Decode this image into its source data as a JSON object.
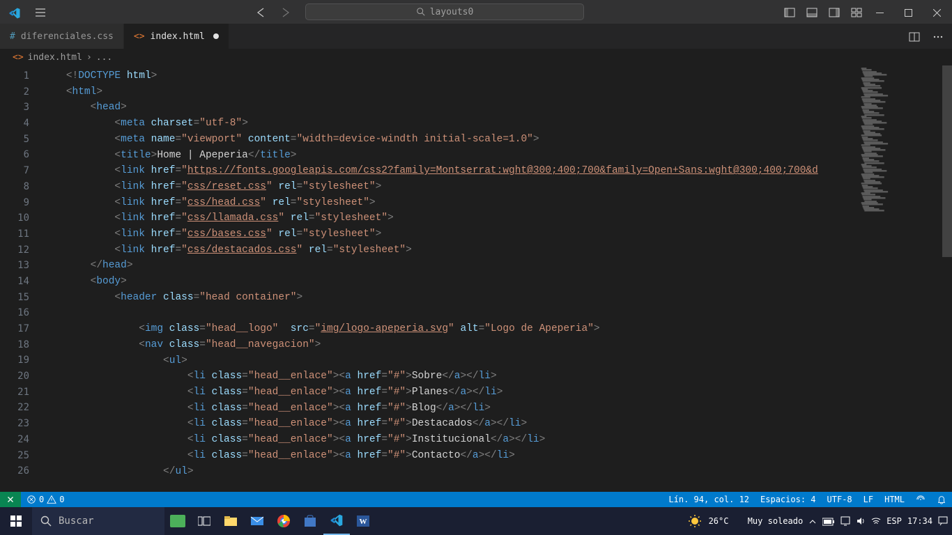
{
  "title_search": "layouts0",
  "tabs": [
    {
      "name": "diferenciales.css",
      "active": false,
      "lang": "css"
    },
    {
      "name": "index.html",
      "active": true,
      "lang": "html",
      "dirty": true
    }
  ],
  "breadcrumb": {
    "file": "index.html",
    "trail": "..."
  },
  "line_numbers": [
    "1",
    "2",
    "3",
    "4",
    "5",
    "6",
    "7",
    "8",
    "9",
    "10",
    "11",
    "12",
    "13",
    "14",
    "15",
    "16",
    "17",
    "18",
    "19",
    "20",
    "21",
    "22",
    "23",
    "24",
    "25",
    "26"
  ],
  "code": {
    "l1": {
      "indent": "    ",
      "tokens": [
        [
          "p",
          "<!"
        ],
        [
          "t",
          "DOCTYPE "
        ],
        [
          "a",
          "html"
        ],
        [
          "p",
          ">"
        ]
      ]
    },
    "l2": {
      "indent": "    ",
      "tokens": [
        [
          "p",
          "<"
        ],
        [
          "t",
          "html"
        ],
        [
          "p",
          ">"
        ]
      ]
    },
    "l3": {
      "indent": "        ",
      "tokens": [
        [
          "p",
          "<"
        ],
        [
          "t",
          "head"
        ],
        [
          "p",
          ">"
        ]
      ]
    },
    "l4": {
      "indent": "            ",
      "tokens": [
        [
          "p",
          "<"
        ],
        [
          "t",
          "meta "
        ],
        [
          "a",
          "charset"
        ],
        [
          "p",
          "="
        ],
        [
          "s",
          "\"utf-8\""
        ],
        [
          "p",
          ">"
        ]
      ]
    },
    "l5": {
      "indent": "            ",
      "tokens": [
        [
          "p",
          "<"
        ],
        [
          "t",
          "meta "
        ],
        [
          "a",
          "name"
        ],
        [
          "p",
          "="
        ],
        [
          "s",
          "\"viewport\" "
        ],
        [
          "a",
          "content"
        ],
        [
          "p",
          "="
        ],
        [
          "s",
          "\"width=device-windth initial-scale=1.0\""
        ],
        [
          "p",
          ">"
        ]
      ]
    },
    "l6": {
      "indent": "            ",
      "tokens": [
        [
          "p",
          "<"
        ],
        [
          "t",
          "title"
        ],
        [
          "p",
          ">"
        ],
        [
          "x",
          "Home | Apeperia"
        ],
        [
          "p",
          "</"
        ],
        [
          "t",
          "title"
        ],
        [
          "p",
          ">"
        ]
      ]
    },
    "l7": {
      "indent": "            ",
      "tokens": [
        [
          "p",
          "<"
        ],
        [
          "t",
          "link "
        ],
        [
          "a",
          "href"
        ],
        [
          "p",
          "="
        ],
        [
          "s",
          "\""
        ],
        [
          "su",
          "https://fonts.googleapis.com/css2?family=Montserrat:wght@300;400;700&family=Open+Sans:wght@300;400;700&d"
        ]
      ]
    },
    "l8": {
      "indent": "            ",
      "tokens": [
        [
          "p",
          "<"
        ],
        [
          "t",
          "link "
        ],
        [
          "a",
          "href"
        ],
        [
          "p",
          "="
        ],
        [
          "s",
          "\""
        ],
        [
          "su",
          "css/reset.css"
        ],
        [
          "s",
          "\" "
        ],
        [
          "a",
          "rel"
        ],
        [
          "p",
          "="
        ],
        [
          "s",
          "\"stylesheet\""
        ],
        [
          "p",
          ">"
        ]
      ]
    },
    "l9": {
      "indent": "            ",
      "tokens": [
        [
          "p",
          "<"
        ],
        [
          "t",
          "link "
        ],
        [
          "a",
          "href"
        ],
        [
          "p",
          "="
        ],
        [
          "s",
          "\""
        ],
        [
          "su",
          "css/head.css"
        ],
        [
          "s",
          "\" "
        ],
        [
          "a",
          "rel"
        ],
        [
          "p",
          "="
        ],
        [
          "s",
          "\"stylesheet\""
        ],
        [
          "p",
          ">"
        ]
      ]
    },
    "l10": {
      "indent": "            ",
      "tokens": [
        [
          "p",
          "<"
        ],
        [
          "t",
          "link "
        ],
        [
          "a",
          "href"
        ],
        [
          "p",
          "="
        ],
        [
          "s",
          "\""
        ],
        [
          "su",
          "css/llamada.css"
        ],
        [
          "s",
          "\" "
        ],
        [
          "a",
          "rel"
        ],
        [
          "p",
          "="
        ],
        [
          "s",
          "\"stylesheet\""
        ],
        [
          "p",
          ">"
        ]
      ]
    },
    "l11": {
      "indent": "            ",
      "tokens": [
        [
          "p",
          "<"
        ],
        [
          "t",
          "link "
        ],
        [
          "a",
          "href"
        ],
        [
          "p",
          "="
        ],
        [
          "s",
          "\""
        ],
        [
          "su",
          "css/bases.css"
        ],
        [
          "s",
          "\" "
        ],
        [
          "a",
          "rel"
        ],
        [
          "p",
          "="
        ],
        [
          "s",
          "\"stylesheet\""
        ],
        [
          "p",
          ">"
        ]
      ]
    },
    "l12": {
      "indent": "            ",
      "tokens": [
        [
          "p",
          "<"
        ],
        [
          "t",
          "link "
        ],
        [
          "a",
          "href"
        ],
        [
          "p",
          "="
        ],
        [
          "s",
          "\""
        ],
        [
          "su",
          "css/destacados.css"
        ],
        [
          "s",
          "\" "
        ],
        [
          "a",
          "rel"
        ],
        [
          "p",
          "="
        ],
        [
          "s",
          "\"stylesheet\""
        ],
        [
          "p",
          ">"
        ]
      ]
    },
    "l13": {
      "indent": "        ",
      "tokens": [
        [
          "p",
          "</"
        ],
        [
          "t",
          "head"
        ],
        [
          "p",
          ">"
        ]
      ]
    },
    "l14": {
      "indent": "        ",
      "tokens": [
        [
          "p",
          "<"
        ],
        [
          "t",
          "body"
        ],
        [
          "p",
          ">"
        ]
      ]
    },
    "l15": {
      "indent": "            ",
      "tokens": [
        [
          "p",
          "<"
        ],
        [
          "t",
          "header "
        ],
        [
          "a",
          "class"
        ],
        [
          "p",
          "="
        ],
        [
          "s",
          "\"head container\""
        ],
        [
          "p",
          ">"
        ]
      ]
    },
    "l16": {
      "indent": "",
      "tokens": []
    },
    "l17": {
      "indent": "                ",
      "tokens": [
        [
          "p",
          "<"
        ],
        [
          "t",
          "img "
        ],
        [
          "a",
          "class"
        ],
        [
          "p",
          "="
        ],
        [
          "s",
          "\"head__logo\"  "
        ],
        [
          "a",
          "src"
        ],
        [
          "p",
          "="
        ],
        [
          "s",
          "\""
        ],
        [
          "su",
          "img/logo-apeperia.svg"
        ],
        [
          "s",
          "\" "
        ],
        [
          "a",
          "alt"
        ],
        [
          "p",
          "="
        ],
        [
          "s",
          "\"Logo de Apeperia\""
        ],
        [
          "p",
          ">"
        ]
      ]
    },
    "l18": {
      "indent": "                ",
      "tokens": [
        [
          "p",
          "<"
        ],
        [
          "t",
          "nav "
        ],
        [
          "a",
          "class"
        ],
        [
          "p",
          "="
        ],
        [
          "s",
          "\"head__navegacion\""
        ],
        [
          "p",
          ">"
        ]
      ]
    },
    "l19": {
      "indent": "                    ",
      "tokens": [
        [
          "p",
          "<"
        ],
        [
          "t",
          "ul"
        ],
        [
          "p",
          ">"
        ]
      ]
    },
    "l20": {
      "indent": "                        ",
      "tokens": [
        [
          "p",
          "<"
        ],
        [
          "t",
          "li "
        ],
        [
          "a",
          "class"
        ],
        [
          "p",
          "="
        ],
        [
          "s",
          "\"head__enlace\""
        ],
        [
          "p",
          "><"
        ],
        [
          "t",
          "a "
        ],
        [
          "a",
          "href"
        ],
        [
          "p",
          "="
        ],
        [
          "s",
          "\"#\""
        ],
        [
          "p",
          ">"
        ],
        [
          "x",
          "Sobre"
        ],
        [
          "p",
          "</"
        ],
        [
          "t",
          "a"
        ],
        [
          "p",
          "></"
        ],
        [
          "t",
          "li"
        ],
        [
          "p",
          ">"
        ]
      ]
    },
    "l21": {
      "indent": "                        ",
      "tokens": [
        [
          "p",
          "<"
        ],
        [
          "t",
          "li "
        ],
        [
          "a",
          "class"
        ],
        [
          "p",
          "="
        ],
        [
          "s",
          "\"head__enlace\""
        ],
        [
          "p",
          "><"
        ],
        [
          "t",
          "a "
        ],
        [
          "a",
          "href"
        ],
        [
          "p",
          "="
        ],
        [
          "s",
          "\"#\""
        ],
        [
          "p",
          ">"
        ],
        [
          "x",
          "Planes"
        ],
        [
          "p",
          "</"
        ],
        [
          "t",
          "a"
        ],
        [
          "p",
          "></"
        ],
        [
          "t",
          "li"
        ],
        [
          "p",
          ">"
        ]
      ]
    },
    "l22": {
      "indent": "                        ",
      "tokens": [
        [
          "p",
          "<"
        ],
        [
          "t",
          "li "
        ],
        [
          "a",
          "class"
        ],
        [
          "p",
          "="
        ],
        [
          "s",
          "\"head__enlace\""
        ],
        [
          "p",
          "><"
        ],
        [
          "t",
          "a "
        ],
        [
          "a",
          "href"
        ],
        [
          "p",
          "="
        ],
        [
          "s",
          "\"#\""
        ],
        [
          "p",
          ">"
        ],
        [
          "x",
          "Blog"
        ],
        [
          "p",
          "</"
        ],
        [
          "t",
          "a"
        ],
        [
          "p",
          "></"
        ],
        [
          "t",
          "li"
        ],
        [
          "p",
          ">"
        ]
      ]
    },
    "l23": {
      "indent": "                        ",
      "tokens": [
        [
          "p",
          "<"
        ],
        [
          "t",
          "li "
        ],
        [
          "a",
          "class"
        ],
        [
          "p",
          "="
        ],
        [
          "s",
          "\"head__enlace\""
        ],
        [
          "p",
          "><"
        ],
        [
          "t",
          "a "
        ],
        [
          "a",
          "href"
        ],
        [
          "p",
          "="
        ],
        [
          "s",
          "\"#\""
        ],
        [
          "p",
          ">"
        ],
        [
          "x",
          "Destacados"
        ],
        [
          "p",
          "</"
        ],
        [
          "t",
          "a"
        ],
        [
          "p",
          "></"
        ],
        [
          "t",
          "li"
        ],
        [
          "p",
          ">"
        ]
      ]
    },
    "l24": {
      "indent": "                        ",
      "tokens": [
        [
          "p",
          "<"
        ],
        [
          "t",
          "li "
        ],
        [
          "a",
          "class"
        ],
        [
          "p",
          "="
        ],
        [
          "s",
          "\"head__enlace\""
        ],
        [
          "p",
          "><"
        ],
        [
          "t",
          "a "
        ],
        [
          "a",
          "href"
        ],
        [
          "p",
          "="
        ],
        [
          "s",
          "\"#\""
        ],
        [
          "p",
          ">"
        ],
        [
          "x",
          "Institucional"
        ],
        [
          "p",
          "</"
        ],
        [
          "t",
          "a"
        ],
        [
          "p",
          "></"
        ],
        [
          "t",
          "li"
        ],
        [
          "p",
          ">"
        ]
      ]
    },
    "l25": {
      "indent": "                        ",
      "tokens": [
        [
          "p",
          "<"
        ],
        [
          "t",
          "li "
        ],
        [
          "a",
          "class"
        ],
        [
          "p",
          "="
        ],
        [
          "s",
          "\"head__enlace\""
        ],
        [
          "p",
          "><"
        ],
        [
          "t",
          "a "
        ],
        [
          "a",
          "href"
        ],
        [
          "p",
          "="
        ],
        [
          "s",
          "\"#\""
        ],
        [
          "p",
          ">"
        ],
        [
          "x",
          "Contacto"
        ],
        [
          "p",
          "</"
        ],
        [
          "t",
          "a"
        ],
        [
          "p",
          "></"
        ],
        [
          "t",
          "li"
        ],
        [
          "p",
          ">"
        ]
      ]
    },
    "l26": {
      "indent": "                    ",
      "tokens": [
        [
          "p",
          "</"
        ],
        [
          "t",
          "ul"
        ],
        [
          "p",
          ">"
        ]
      ]
    }
  },
  "statusbar": {
    "errors": "0",
    "warnings": "0",
    "position": "Lín. 94, col. 12",
    "spaces": "Espacios: 4",
    "encoding": "UTF-8",
    "eol": "LF",
    "lang": "HTML"
  },
  "taskbar": {
    "search_placeholder": "Buscar",
    "weather_temp": "26°C",
    "weather_desc": "Muy soleado",
    "lang": "ESP",
    "time": "17:34"
  }
}
